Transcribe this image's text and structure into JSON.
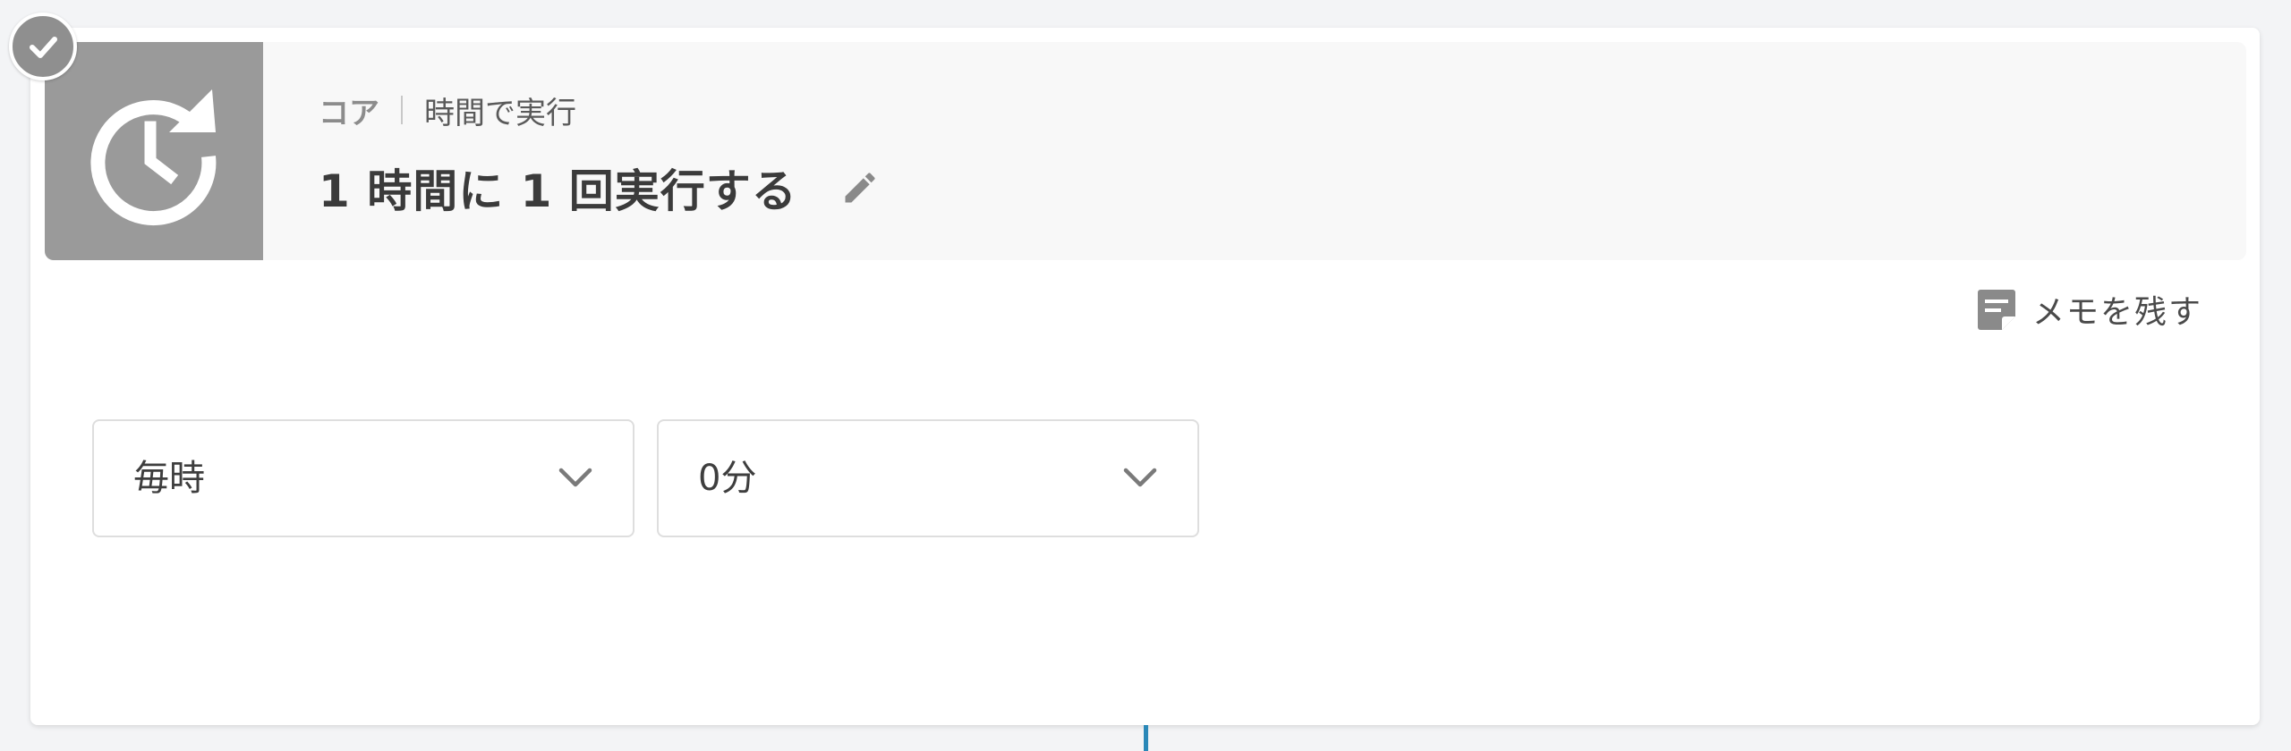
{
  "step": {
    "category": "コア",
    "trigger_name": "時間で実行",
    "title": "1 時間に 1 回実行する",
    "icon": "clock-repeat-icon",
    "completed": true
  },
  "memo": {
    "label": "メモを残す",
    "icon": "note-icon"
  },
  "schedule": {
    "frequency": "毎時",
    "minute": "0分"
  },
  "colors": {
    "icon_tile": "#9a9a9a",
    "connector": "#2a88b8",
    "badge": "#8f8f8f"
  }
}
